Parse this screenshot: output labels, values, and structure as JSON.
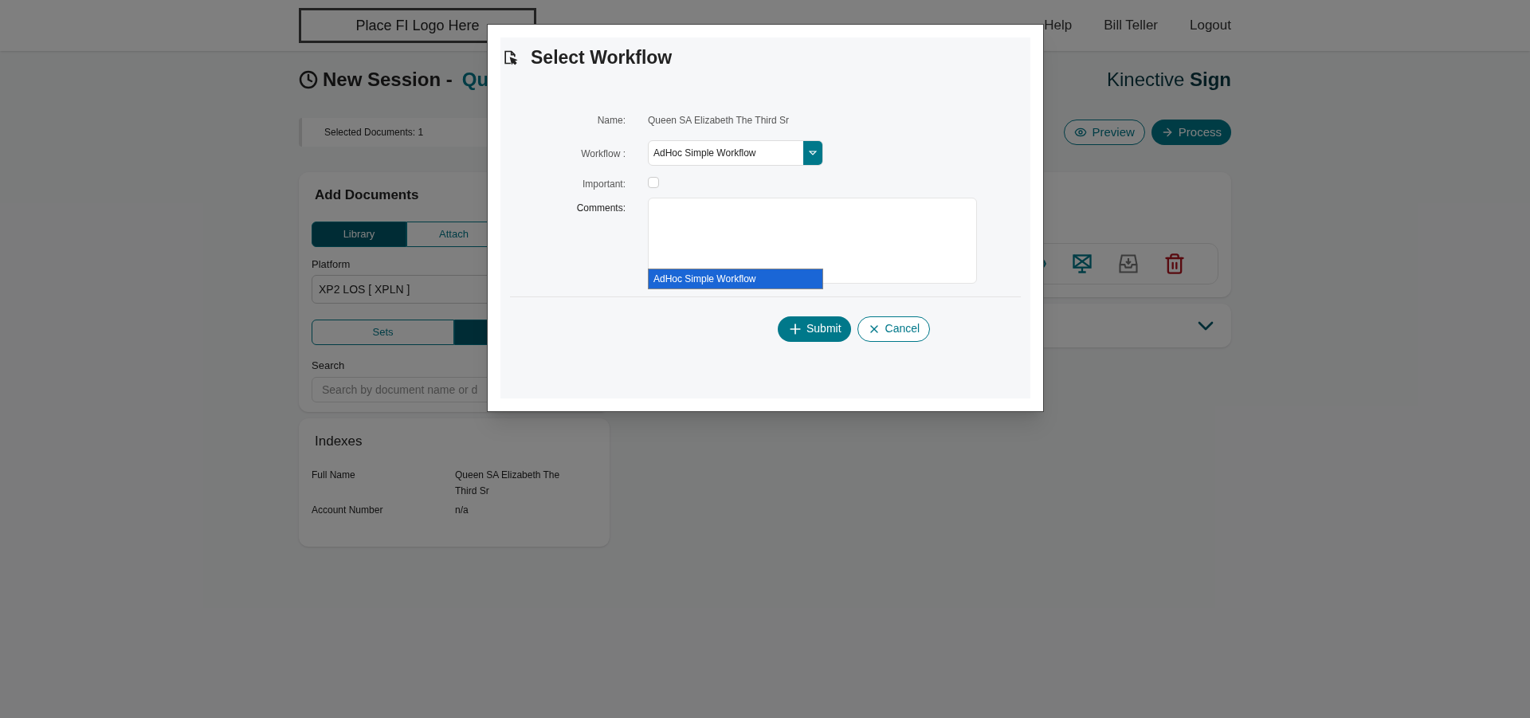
{
  "header": {
    "logo": "Place FI Logo Here",
    "nav": [
      "Help",
      "Bill Teller",
      "Logout"
    ]
  },
  "page": {
    "title": "New Session -",
    "title_name": "Qu",
    "brand": "Kinective **Sign**"
  },
  "selection_bar": {
    "text": "Selected Documents: 1"
  },
  "actions": [
    {
      "kind": "preview",
      "label": "Preview"
    },
    {
      "kind": "process",
      "label": "Process"
    }
  ],
  "add_documents": {
    "title": "Add Documents",
    "source_tabs": [
      {
        "label": "Library",
        "selected": true
      },
      {
        "label": "Attach",
        "selected": false
      }
    ],
    "platform_label": "Platform",
    "platform_value": "XP2 LOS [ XPLN ]",
    "mode_tabs": [
      {
        "label": "Sets",
        "selected": false
      },
      {
        "selected": true
      }
    ],
    "search_label": "Search",
    "search_placeholder": "Search by document name or d"
  },
  "indexes": {
    "title": "Indexes",
    "rows": [
      {
        "label": "Full Name",
        "value": "Queen SA Elizabeth The Third Sr"
      },
      {
        "label": "Account Number",
        "value": "n/a"
      }
    ]
  },
  "document_tools": [
    {
      "kind": "view"
    },
    {
      "kind": "screen"
    },
    {
      "kind": "inbox"
    },
    {
      "kind": "delete"
    }
  ],
  "modal": {
    "title": "Select Workflow",
    "name_label": "Name:",
    "name_value": "Queen SA Elizabeth The Third Sr",
    "workflow_label": "Workflow :",
    "workflow_value": "AdHoc Simple Workflow",
    "workflow_options": [
      {
        "label": "AdHoc Simple Workflow",
        "selected": true
      }
    ],
    "important_label": "Important:",
    "important_checked": false,
    "comments_label": "Comments:",
    "buttons": [
      {
        "kind": "submit",
        "label": "Submit"
      },
      {
        "kind": "cancel",
        "label": "Cancel"
      }
    ]
  }
}
